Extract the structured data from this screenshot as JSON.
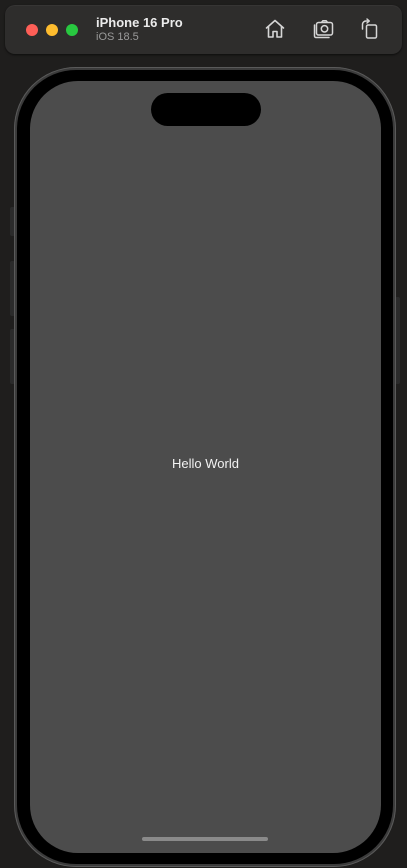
{
  "titlebar": {
    "device_name": "iPhone 16 Pro",
    "os_version": "iOS 18.5",
    "buttons": [
      {
        "icon": "home-icon"
      },
      {
        "icon": "screenshot-icon"
      },
      {
        "icon": "rotate-icon"
      }
    ]
  },
  "traffic_lights": {
    "close_color": "#fe5f57",
    "minimize_color": "#febc2e",
    "zoom_color": "#28c840"
  },
  "screen": {
    "background": "#4c4c4c",
    "text": "Hello World"
  }
}
